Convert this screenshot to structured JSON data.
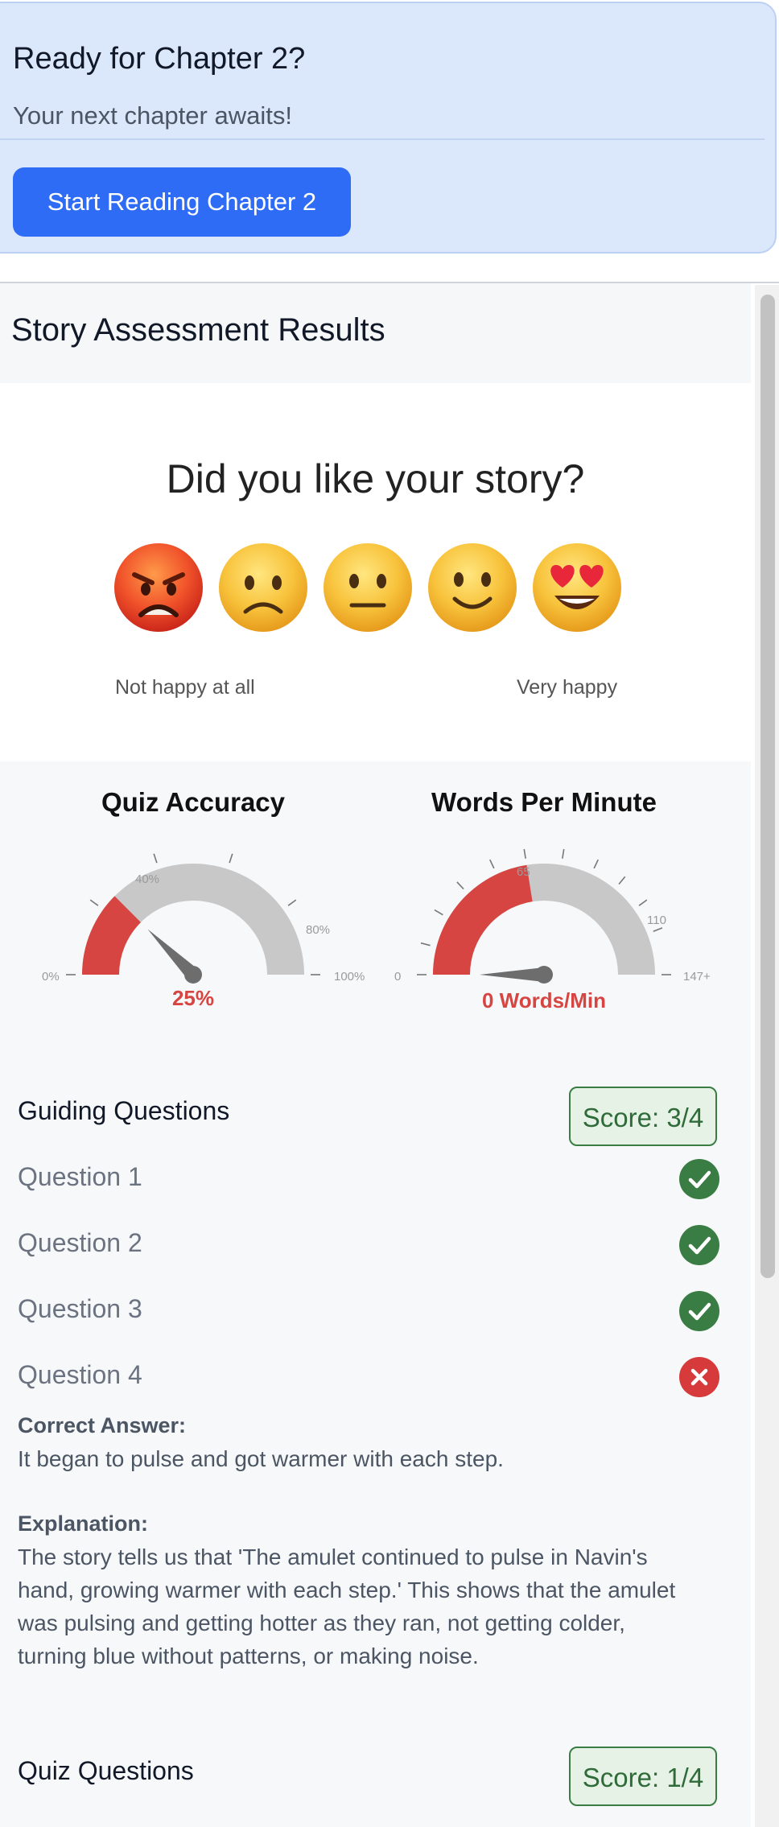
{
  "cta": {
    "title": "Ready for Chapter 2?",
    "subtitle": "Your next chapter awaits!",
    "button_label": "Start Reading Chapter 2"
  },
  "assessment": {
    "title": "Story Assessment Results",
    "rating": {
      "question": "Did you like your story?",
      "options": [
        "angry-face",
        "slightly-frowning-face",
        "neutral-face",
        "slightly-smiling-face",
        "heart-eyes-face"
      ],
      "low_label": "Not happy at all",
      "high_label": "Very happy"
    },
    "gauges": {
      "quiz_accuracy": {
        "title": "Quiz Accuracy",
        "value_percent": 25,
        "value_label": "25%",
        "tick_labels": [
          "0%",
          "40%",
          "80%",
          "100%"
        ]
      },
      "words_per_minute": {
        "title": "Words Per Minute",
        "value": 0,
        "max": 147,
        "value_label": "0 Words/Min",
        "tick_labels": [
          "0",
          "65",
          "110",
          "147+"
        ]
      }
    },
    "guiding": {
      "title": "Guiding Questions",
      "score": "Score: 3/4",
      "questions": [
        {
          "label": "Question 1",
          "correct": true
        },
        {
          "label": "Question 2",
          "correct": true
        },
        {
          "label": "Question 3",
          "correct": true
        },
        {
          "label": "Question 4",
          "correct": false
        }
      ],
      "correct_answer_heading": "Correct Answer:",
      "correct_answer": "It began to pulse and got warmer with each step.",
      "explanation_heading": "Explanation:",
      "explanation_lines": [
        "The story tells us that 'The amulet continued to pulse in Navin's",
        "hand, growing warmer with each step.' This shows that the amulet",
        "was pulsing and getting hotter as they ran, not getting colder,",
        "turning blue without patterns, or making noise."
      ]
    },
    "quiz": {
      "title": "Quiz Questions",
      "score": "Score: 1/4"
    }
  },
  "colors": {
    "accent": "#2f6cf5",
    "gauge_fill": "#d64541",
    "gauge_track": "#c8c8c8",
    "correct": "#3a7d44",
    "incorrect": "#d63a3a"
  }
}
